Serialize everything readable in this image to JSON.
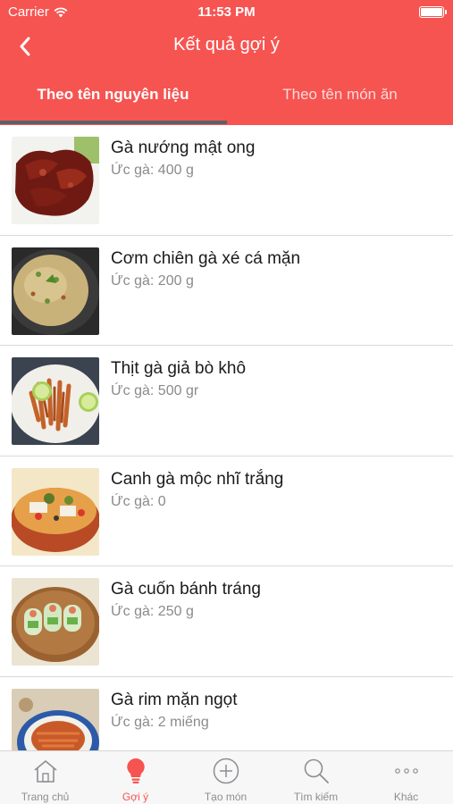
{
  "status_bar": {
    "carrier": "Carrier",
    "time": "11:53 PM"
  },
  "nav": {
    "title": "Kết quả gợi ý",
    "back_icon": "chevron-left-icon"
  },
  "tabs": [
    {
      "label": "Theo tên nguyên liệu",
      "selected": true
    },
    {
      "label": "Theo tên món ăn",
      "selected": false
    }
  ],
  "recipes": [
    {
      "title": "Gà nướng mật ong",
      "subtitle": "Ức gà: 400 g",
      "image": "honey-grilled-chicken-photo"
    },
    {
      "title": "Cơm chiên gà xé cá mặn",
      "subtitle": "Ức gà: 200 g",
      "image": "fried-rice-photo"
    },
    {
      "title": "Thịt gà giả bò khô",
      "subtitle": "Ức gà: 500 gr",
      "image": "chicken-jerky-photo"
    },
    {
      "title": "Canh gà mộc nhĩ trắng",
      "subtitle": "Ức gà: 0",
      "image": "chicken-soup-photo"
    },
    {
      "title": "Gà cuốn bánh tráng",
      "subtitle": "Ức gà: 250 g",
      "image": "spring-rolls-photo"
    },
    {
      "title": "Gà rim mặn ngọt",
      "subtitle": "Ức gà: 2 miếng",
      "image": "braised-chicken-photo"
    }
  ],
  "tab_bar": [
    {
      "label": "Trang chủ",
      "icon": "home-icon",
      "active": false
    },
    {
      "label": "Gợi ý",
      "icon": "lightbulb-icon",
      "active": true
    },
    {
      "label": "Tạo món",
      "icon": "plus-circle-icon",
      "active": false
    },
    {
      "label": "Tìm kiếm",
      "icon": "search-icon",
      "active": false
    },
    {
      "label": "Khác",
      "icon": "more-icon",
      "active": false
    }
  ],
  "colors": {
    "accent": "#f65451",
    "tab_underline": "#5c6069",
    "inactive": "#8e8e93"
  }
}
